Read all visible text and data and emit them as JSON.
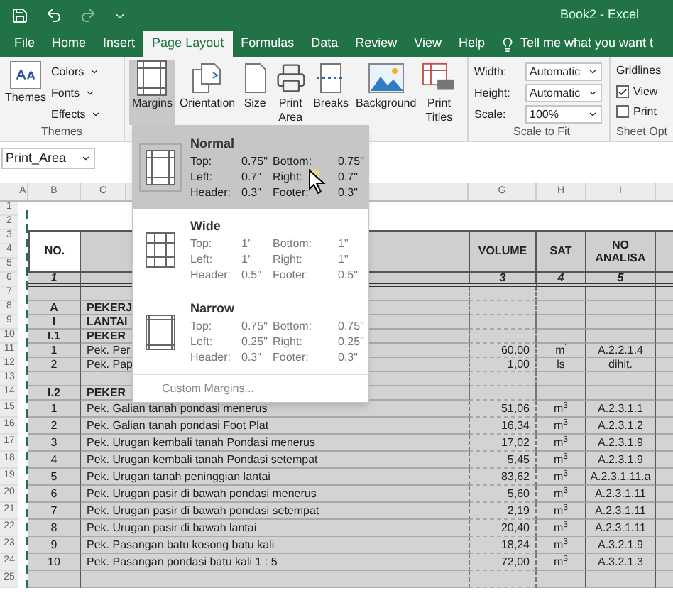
{
  "window": {
    "title": "Book2  -  Excel"
  },
  "tabs": [
    {
      "label": "File",
      "selected": false
    },
    {
      "label": "Home",
      "selected": false
    },
    {
      "label": "Insert",
      "selected": false
    },
    {
      "label": "Page Layout",
      "selected": true
    },
    {
      "label": "Formulas",
      "selected": false
    },
    {
      "label": "Data",
      "selected": false
    },
    {
      "label": "Review",
      "selected": false
    },
    {
      "label": "View",
      "selected": false
    },
    {
      "label": "Help",
      "selected": false
    }
  ],
  "tell_me": "Tell me what you want t",
  "themes_group": {
    "button": "Themes",
    "options": [
      "Colors",
      "Fonts",
      "Effects"
    ],
    "label": "Themes"
  },
  "page_setup_group": {
    "buttons": [
      {
        "kind": "margins",
        "label": "Margins",
        "pressed": true
      },
      {
        "kind": "orientation",
        "label": "Orientation",
        "pressed": false
      },
      {
        "kind": "size",
        "label": "Size",
        "pressed": false
      },
      {
        "kind": "print_area",
        "label": "Print Area",
        "pressed": false
      },
      {
        "kind": "breaks",
        "label": "Breaks",
        "pressed": false
      },
      {
        "kind": "background",
        "label": "Background",
        "pressed": false
      },
      {
        "kind": "print_titles",
        "label": "Print Titles",
        "pressed": false
      }
    ]
  },
  "scale_group": {
    "fields": [
      {
        "label": "Width:",
        "value": "Automatic"
      },
      {
        "label": "Height:",
        "value": "Automatic"
      },
      {
        "label": "Scale:",
        "value": "100%"
      }
    ],
    "label": "Scale to Fit"
  },
  "sheet_options": {
    "title": "Gridlines",
    "checks": [
      {
        "label": "View",
        "checked": true
      },
      {
        "label": "Print",
        "checked": false
      }
    ],
    "label": "Sheet Opt"
  },
  "name_box": "Print_Area",
  "columns": [
    "A",
    "B",
    "C",
    "G",
    "H",
    "I"
  ],
  "row_numbers": [
    "1",
    "2",
    "3",
    "4",
    "5",
    "6",
    "7",
    "8",
    "9",
    "10",
    "11",
    "12",
    "13",
    "14",
    "15",
    "16",
    "17",
    "18",
    "19",
    "20",
    "21",
    "22",
    "23",
    "24",
    "25"
  ],
  "table": {
    "header": {
      "no": "NO.",
      "volume": "VOLUME",
      "unit": "SAT",
      "analysis": "NO ANALISA"
    },
    "index_row": {
      "no": "1",
      "volume": "3",
      "unit": "4",
      "analysis": "5"
    },
    "rows": [
      {
        "kind": "blank"
      },
      {
        "kind": "section",
        "no": "A",
        "description": "PEKERJ"
      },
      {
        "kind": "section",
        "no": "I",
        "description": "LANTAI"
      },
      {
        "kind": "section",
        "no": "I.1",
        "description": "PEKER"
      },
      {
        "kind": "item",
        "no": "1",
        "description": "Pek. Per",
        "volume": "60,00",
        "unit": "m$^{'}$",
        "analysis": "A.2.2.1.4"
      },
      {
        "kind": "item",
        "no": "2",
        "description": "Pek. Pap",
        "volume": "1,00",
        "unit": "ls",
        "analysis": "dihit."
      },
      {
        "kind": "blank"
      },
      {
        "kind": "section",
        "no": "I.2",
        "description": "PEKER"
      },
      {
        "kind": "item",
        "no": "1",
        "description": "Pek. Galian tanah  pondasi menerus",
        "volume": "51,06",
        "unit": "m$^{3}$",
        "analysis": "A.2.3.1.1"
      },
      {
        "kind": "item",
        "no": "2",
        "description": "Pek. Galian tanah  pondasi Foot Plat",
        "volume": "16,34",
        "unit": "m$^{3}$",
        "analysis": "A.2.3.1.2"
      },
      {
        "kind": "item",
        "no": "3",
        "description": "Pek. Urugan kembali tanah Pondasi menerus",
        "volume": "17,02",
        "unit": "m$^{3}$",
        "analysis": "A.2.3.1.9"
      },
      {
        "kind": "item",
        "no": "4",
        "description": "Pek. Urugan kembali tanah Pondasi setempat",
        "volume": "5,45",
        "unit": "m$^{3}$",
        "analysis": "A.2.3.1.9"
      },
      {
        "kind": "item",
        "no": "5",
        "description": "Pek. Urugan tanah peninggian lantai",
        "volume": "83,62",
        "unit": "m$^{3}$",
        "analysis": "A.2.3.1.11.a"
      },
      {
        "kind": "item",
        "no": "6",
        "description": "Pek. Urugan pasir di bawah pondasi menerus",
        "volume": "5,60",
        "unit": "m$^{3}$",
        "analysis": "A.2.3.1.11"
      },
      {
        "kind": "item",
        "no": "7",
        "description": "Pek. Urugan pasir di bawah pondasi setempat",
        "volume": "2,19",
        "unit": "m$^{3}$",
        "analysis": "A.2.3.1.11"
      },
      {
        "kind": "item",
        "no": "8",
        "description": "Pek. Urugan pasir di bawah lantai",
        "volume": "20,40",
        "unit": "m$^{3}$",
        "analysis": "A.2.3.1.11"
      },
      {
        "kind": "item",
        "no": "9",
        "description": "Pek. Pasangan batu kosong batu kali",
        "volume": "18,24",
        "unit": "m$^{3}$",
        "analysis": "A.3.2.1.9"
      },
      {
        "kind": "item",
        "no": "10",
        "description": "Pek. Pasangan pondasi batu kali 1 : 5",
        "volume": "72,00",
        "unit": "m$^{3}$",
        "analysis": "A.3.2.1.3"
      },
      {
        "kind": "blank"
      }
    ]
  },
  "margins_menu": {
    "items": [
      {
        "kind": "normal",
        "name": "Normal",
        "selected": true,
        "fields": [
          {
            "label": "Top:",
            "value": "0.75\""
          },
          {
            "label": "Bottom:",
            "value": "0.75\""
          },
          {
            "label": "Left:",
            "value": "0.7\""
          },
          {
            "label": "Right:",
            "value": "0.7\""
          },
          {
            "label": "Header:",
            "value": "0.3\""
          },
          {
            "label": "Footer:",
            "value": "0.3\""
          }
        ]
      },
      {
        "kind": "wide",
        "name": "Wide",
        "selected": false,
        "fields": [
          {
            "label": "Top:",
            "value": "1\""
          },
          {
            "label": "Bottom:",
            "value": "1\""
          },
          {
            "label": "Left:",
            "value": "1\""
          },
          {
            "label": "Right:",
            "value": "1\""
          },
          {
            "label": "Header:",
            "value": "0.5\""
          },
          {
            "label": "Footer:",
            "value": "0.5\""
          }
        ]
      },
      {
        "kind": "narrow",
        "name": "Narrow",
        "selected": false,
        "fields": [
          {
            "label": "Top:",
            "value": "0.75\""
          },
          {
            "label": "Bottom:",
            "value": "0.75\""
          },
          {
            "label": "Left:",
            "value": "0.25\""
          },
          {
            "label": "Right:",
            "value": "0.25\""
          },
          {
            "label": "Header:",
            "value": "0.3\""
          },
          {
            "label": "Footer:",
            "value": "0.3\""
          }
        ]
      }
    ],
    "custom": "Custom Margins..."
  }
}
